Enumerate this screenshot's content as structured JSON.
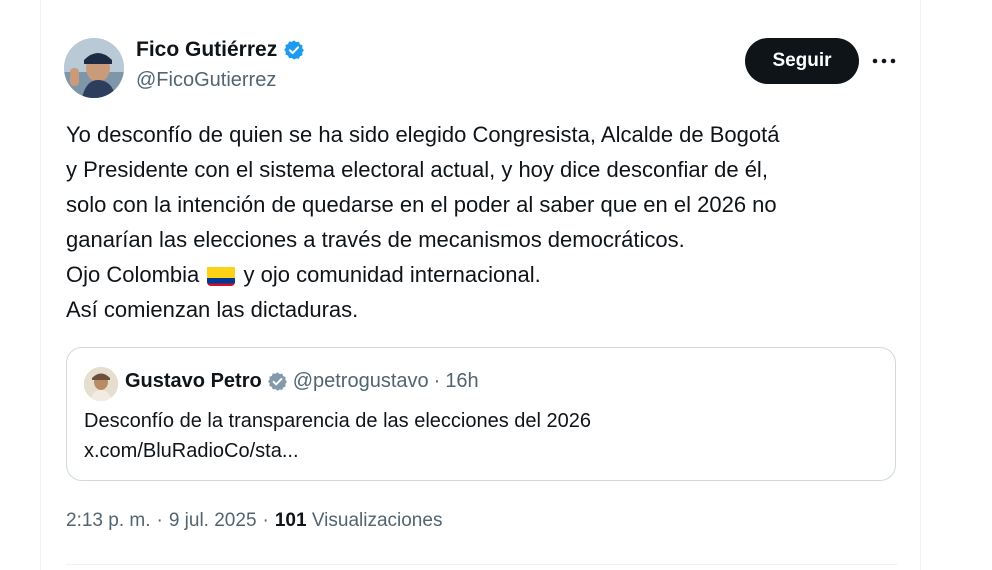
{
  "author": {
    "name": "Fico Gutiérrez",
    "handle": "@FicoGutierrez"
  },
  "follow_label": "Seguir",
  "tweet": {
    "lines": [
      "Yo desconfío de quien se ha sido elegido Congresista, Alcalde de Bogotá",
      "y Presidente  con el sistema electoral actual, y hoy dice desconfiar de él,",
      "solo con la intención de quedarse en el poder al saber que en el 2026 no",
      "ganarían las elecciones a través de mecanismos democráticos."
    ],
    "line5_before": "Ojo Colombia",
    "line5_after": "y ojo comunidad internacional.",
    "line6": "Así comienzan las dictaduras."
  },
  "quote": {
    "name": "Gustavo Petro",
    "handle": "@petrogustavo",
    "separator": "·",
    "time": "16h",
    "text": "Desconfío de la transparencia de las elecciones del 2026",
    "link": "x.com/BluRadioCo/sta..."
  },
  "meta": {
    "time": "2:13 p. m.",
    "sep1": "·",
    "date": "9 jul. 2025",
    "sep2": "·",
    "views_count": "101",
    "views_label": "Visualizaciones"
  },
  "colors": {
    "verified": "#1d9bf0",
    "flag_yellow": "#fcd116",
    "flag_blue": "#003893",
    "flag_red": "#ce1126"
  }
}
